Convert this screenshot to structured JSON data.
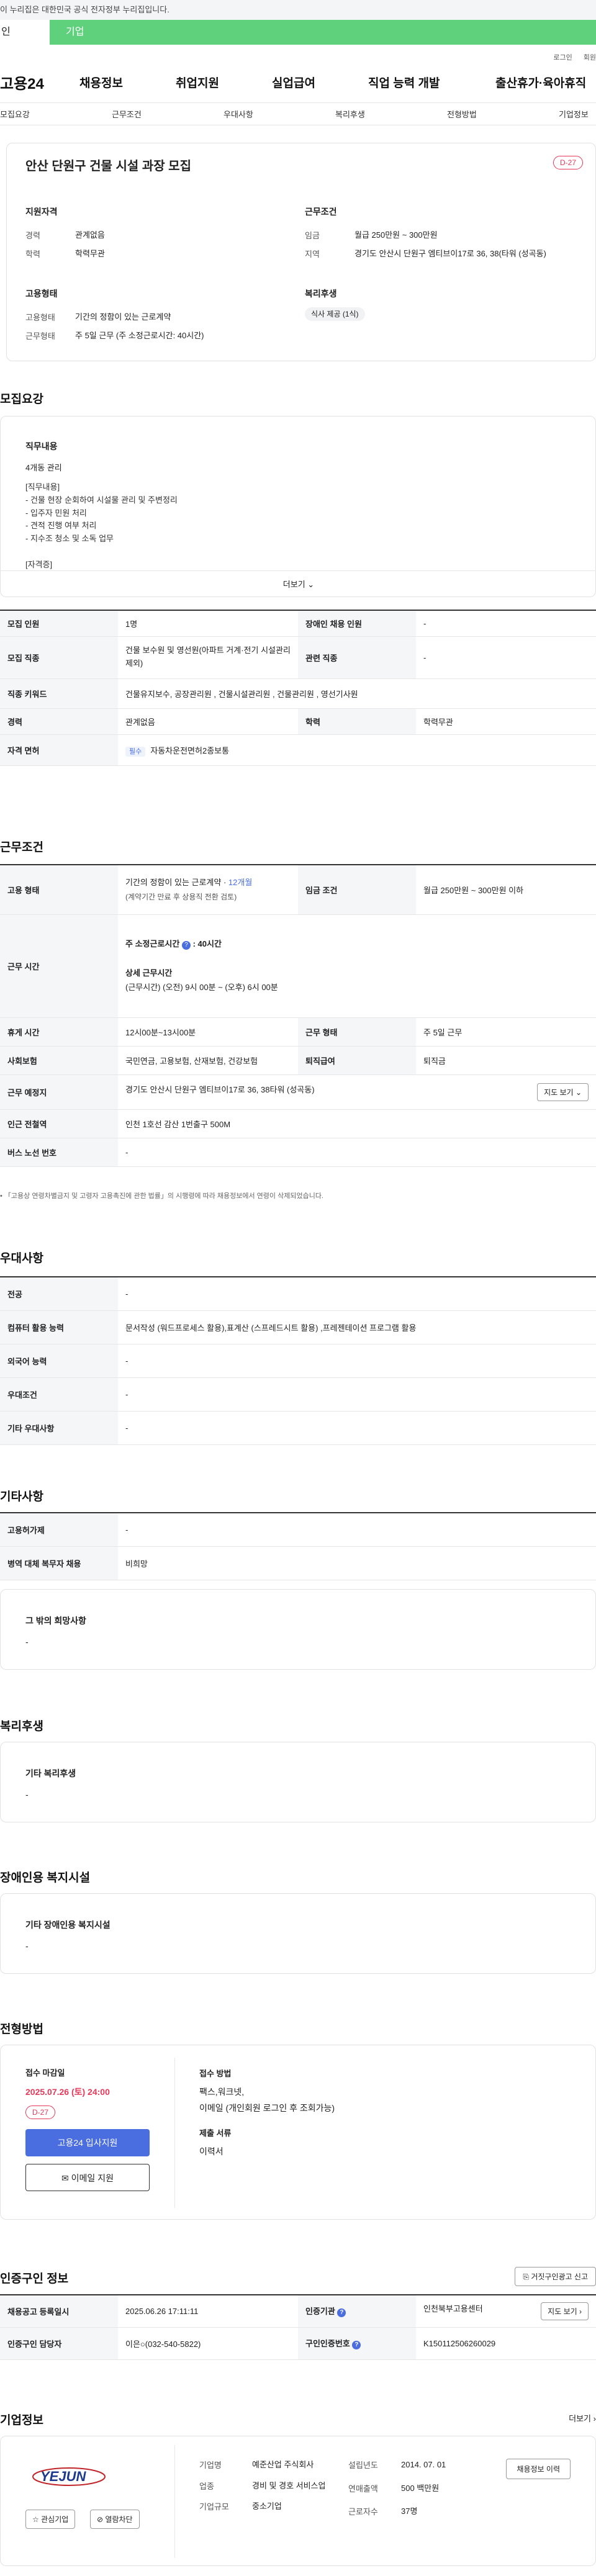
{
  "gov_notice": "이 누리집은 대한민국 공식 전자정부 누리집입니다.",
  "tabs": {
    "first": "인",
    "second": "기업"
  },
  "util": {
    "login": "로그인",
    "join": "회원"
  },
  "gnb": {
    "logo": "고용24",
    "menu": [
      "채용정보",
      "취업지원",
      "실업급여",
      "직업 능력 개발",
      "출산휴가·육아휴직"
    ]
  },
  "subnav": [
    "모집요강",
    "근무조건",
    "우대사항",
    "복리후생",
    "전형방법",
    "기업정보"
  ],
  "job": {
    "title": "안산 단원구 건물 시설 과장 모집",
    "dday": "D-27",
    "qual_title": "지원자격",
    "qual": [
      {
        "k": "경력",
        "v": "관계없음"
      },
      {
        "k": "학력",
        "v": "학력무관"
      }
    ],
    "cond_title": "근무조건",
    "cond": [
      {
        "k": "임금",
        "v": "월급 250만원 ~ 300만원"
      },
      {
        "k": "지역",
        "v": "경기도 안산시 단원구 엠티브이17로 36, 38(타워 (성곡동)"
      }
    ],
    "emp_title": "고용형태",
    "emp": [
      {
        "k": "고용형태",
        "v": "기간의 정함이 있는 근로계약"
      },
      {
        "k": "근무형태",
        "v": "주 5일 근무 (주 소정근로시간: 40시간)"
      }
    ],
    "welfare_title": "복리후생",
    "welfare_tag": "식사 제공 (1식)"
  },
  "recruit": {
    "title": "모집요강",
    "duty_title": "직무내용",
    "duty_sub": "4개동 관리",
    "duty_text": "[직무내용]\n- 건물 현장 순회하여 시설물 관리 및 주변정리\n- 입주자 민원 처리\n- 견적 진행 여부 처리\n- 지수조 청소 및 소독 업무\n\n[자격증]",
    "more": "더보기"
  },
  "recruit_table": {
    "r1": {
      "h1": "모집 인원",
      "v1": "1명",
      "h2": "장애인 채용 인원",
      "v2": "-"
    },
    "r2": {
      "h1": "모집 직종",
      "v1": "건물 보수원 및 영선원(아파트 거계·전기 시설관리 제외)",
      "h2": "관련 직종",
      "v2": "-"
    },
    "r3": {
      "h1": "직종 키워드",
      "v1": "건물유지보수, 공장관리원 , 건물시설관리원 , 건물관리원 , 영선기사원"
    },
    "r4": {
      "h1": "경력",
      "v1": "관계없음",
      "h2": "학력",
      "v2": "학력무관"
    },
    "r5": {
      "h1": "자격 면허",
      "tag": "필수",
      "v1": "자동차운전면허2종보통"
    }
  },
  "work": {
    "title": "근무조건",
    "r1": {
      "h1": "고용 형태",
      "v1a": "기간의 정함이 있는 근로계약 · ",
      "v1b": "12개월",
      "v1c": "(계약기간 만료 후 상용직 전환 검토)",
      "h2": "임금 조건",
      "v2": "월급 250만원 ~ 300만원 이하"
    },
    "r2": {
      "h1": "근무 시간",
      "a": "주 소정근로시간",
      "b": ": 40시간",
      "c": "상세 근무시간",
      "d": "(근무시간) (오전) 9시 00분 ~ (오후) 6시 00분"
    },
    "r3": {
      "h1": "휴게 시간",
      "v1": "12시00분~13시00분",
      "h2": "근무 형태",
      "v2": "주 5일 근무"
    },
    "r4": {
      "h1": "사회보험",
      "v1": "국민연금, 고용보험, 산재보험, 건강보험",
      "h2": "퇴직급여",
      "v2": "퇴직금"
    },
    "r5": {
      "h1": "근무 예정지",
      "v1": "경기도 안산시 단원구 엠티브이17로 36, 38타워 (성곡동)",
      "btn": "지도 보기"
    },
    "r6": {
      "h1": "인근 전철역",
      "v1": "인천 1호선 감산 1번출구 500M"
    },
    "r7": {
      "h1": "버스 노선 번호",
      "v1": "-"
    },
    "note": "「고용상 연령차별금지 및 고령자 고용촉진에 관한 법률」의 시행령에 따라 채용정보에서 연령이 삭제되었습니다."
  },
  "pref": {
    "title": "우대사항",
    "rows": [
      {
        "h": "전공",
        "v": "-"
      },
      {
        "h": "컴퓨터 활용 능력",
        "v": "문서작성 (워드프로세스 활용),표계산 (스프레드시트 활용) ,프레젠테이션 프로그램 활용"
      },
      {
        "h": "외국어 능력",
        "v": "-"
      },
      {
        "h": "우대조건",
        "v": "-"
      },
      {
        "h": "기타 우대사항",
        "v": "-"
      }
    ]
  },
  "etc": {
    "title": "기타사항",
    "rows": [
      {
        "h": "고용허가제",
        "v": "-"
      },
      {
        "h": "병역 대체 복무자 채용",
        "v": "비희망"
      }
    ],
    "other_title": "그 밖의 희망사항",
    "other_v": "-"
  },
  "benefit": {
    "title": "복리후생",
    "sub": "기타 복리후생",
    "v": "-"
  },
  "disabled": {
    "title": "장애인용 복지시설",
    "sub": "기타 장애인용 복지시설",
    "v": "-"
  },
  "apply": {
    "title": "전형방법",
    "deadline_label": "접수 마감일",
    "deadline": "2025.07.26 (토) 24:00",
    "dday": "D-27",
    "btn_apply": "고용24 입사지원",
    "btn_email": "이메일 지원",
    "method_label": "접수 방법",
    "method_v1": "팩스,워크넷,",
    "method_v2": "이메일 (개인회원 로그인 후 조회가능)",
    "docs_label": "제출 서류",
    "docs_v": "이력서"
  },
  "cert": {
    "title": "인증구인 정보",
    "report_btn": "거짓구인광고 신고",
    "r1": {
      "h1": "채용공고 등록일시",
      "v1": "2025.06.26 17:11:11",
      "h2": "인증기관",
      "v2": "인천북부고용센터",
      "btn": "지도 보기"
    },
    "r2": {
      "h1": "인증구인 담당자",
      "v1": "이은○(032-540-5822)",
      "h2": "구인인증번호",
      "v2": "K150112506260029"
    }
  },
  "company": {
    "title": "기업정보",
    "more": "더보기",
    "logo_text": "YEJUN",
    "fav": "관심기업",
    "block": "열람차단",
    "rows": [
      {
        "k": "기업명",
        "v": "예준산업 주식회사"
      },
      {
        "k": "업종",
        "v": "경비 및 경호 서비스업"
      },
      {
        "k": "기업규모",
        "v": "중소기업"
      }
    ],
    "rows2": [
      {
        "k": "설립년도",
        "v": "2014. 07. 01"
      },
      {
        "k": "연매출액",
        "v": "500 백만원"
      },
      {
        "k": "근로자수",
        "v": "37명"
      }
    ],
    "btn": "채용정보 이력"
  },
  "colors": {
    "accent": "#4a6ee0",
    "green": "#5fd17d",
    "red": "#e5395a"
  }
}
